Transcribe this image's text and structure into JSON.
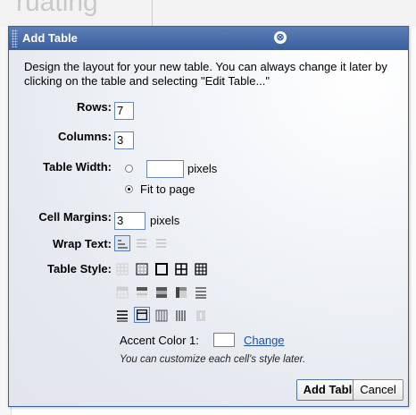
{
  "background": {
    "heading_fragment": "ruating"
  },
  "dialog": {
    "title": "Add Table",
    "close_glyph": "⊗",
    "description": "Design the layout for your new table. You can always change it later by clicking on the table and selecting \"Edit Table...\"",
    "rows": {
      "label": "Rows:",
      "value": "7"
    },
    "columns": {
      "label": "Columns:",
      "value": "3"
    },
    "table_width": {
      "label": "Table Width:",
      "pixels_value": "",
      "pixels_unit": "pixels",
      "fit_label": "Fit to page",
      "selected": "fit"
    },
    "cell_margins": {
      "label": "Cell Margins:",
      "value": "3",
      "unit": "pixels"
    },
    "wrap_text": {
      "label": "Wrap Text:",
      "options": [
        "wrap",
        "no-wrap",
        "shrink"
      ],
      "selected": 0
    },
    "table_style": {
      "label": "Table Style:",
      "selected_index": 11
    },
    "accent": {
      "label": "Accent Color 1:",
      "change_label": "Change",
      "color": "#ffffff"
    },
    "note": "You can customize each cell's style later.",
    "buttons": {
      "add": "Add Table",
      "cancel": "Cancel"
    },
    "colors": {
      "titlebar": "#3a5f9f",
      "accent_link": "#1f4fa0"
    }
  }
}
